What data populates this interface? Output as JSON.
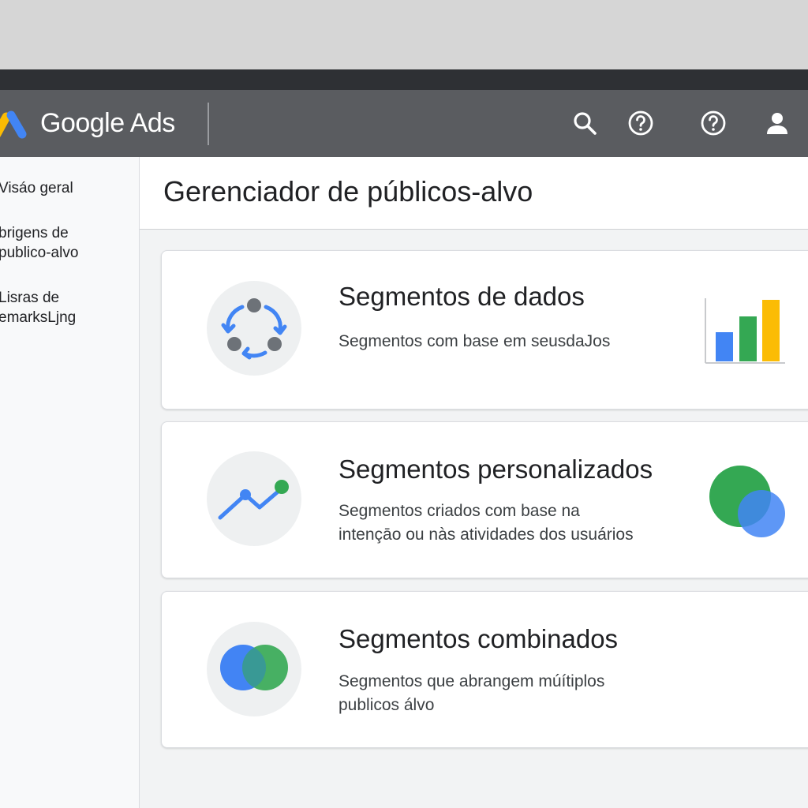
{
  "header": {
    "brand": "Google Ads",
    "icons": [
      "search-icon",
      "help-icon",
      "help-icon",
      "account-icon"
    ]
  },
  "sidebar": {
    "items": [
      {
        "label": "Visáo geral"
      },
      {
        "label": "brigens de\npublico-alvo"
      },
      {
        "label": "Lisras de\nemarksLjng"
      }
    ]
  },
  "page": {
    "title": "Gerenciador de públicos-alvo"
  },
  "cards": [
    {
      "title": "Segmentos de dados",
      "description": "Segmentos com base em seusdaJos",
      "icon": "cycle-icon",
      "illustration": "bar-chart-illustration"
    },
    {
      "title": "Segmentos personalizados",
      "description": "Segmentos criados com base na\nintençāo ou nàs atividades dos usuários",
      "icon": "trend-icon",
      "illustration": "overlap-circles-illustration"
    },
    {
      "title": "Segmentos combinados",
      "description": "Segmentos que abrangem múítiplos\npublicos álvo",
      "icon": "venn-icon"
    }
  ],
  "colors": {
    "blue": "#4285f4",
    "green": "#34a853",
    "yellow": "#fbbc04",
    "topbar": "#5a5c60"
  }
}
